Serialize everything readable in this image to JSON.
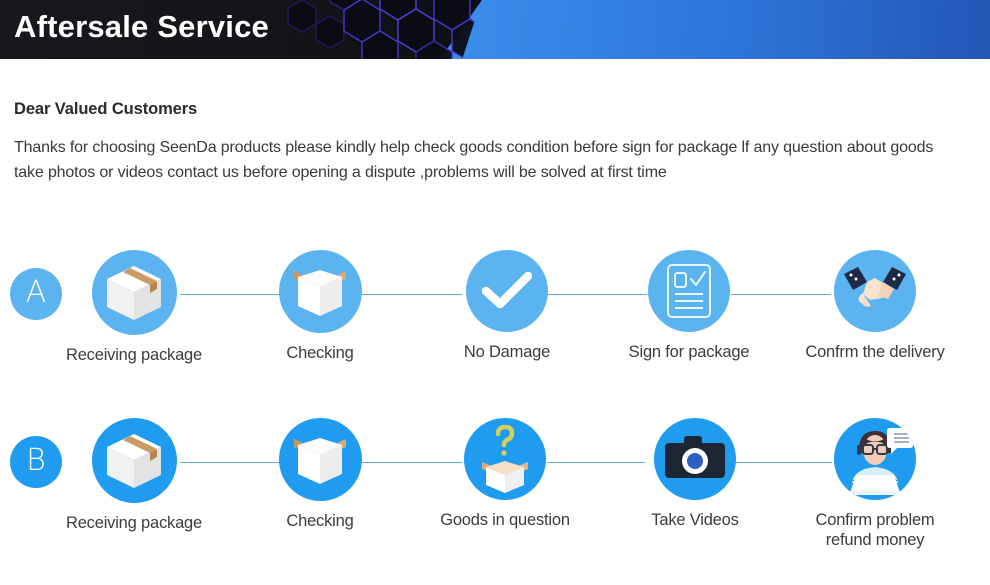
{
  "header": {
    "title": "Aftersale Service",
    "dark_bg": "#14151a",
    "blue_accent": "#3f93f1",
    "hex_stroke": "#3b2ea8"
  },
  "intro": {
    "greeting": "Dear Valued Customers",
    "body": "Thanks for choosing SeenDa products please kindly help check goods condition before sign for package lf any question about goods take photos or videos contact us before opening a dispute ,problems will be solved at first time"
  },
  "colors": {
    "row_a_blue": "#5bb4ef",
    "row_b_blue": "#1f9bf0",
    "connector_line": "#63aecb",
    "label_text": "#3c3c3c",
    "box_tan": "#c99a63",
    "box_white": "#fbfbfb",
    "camera_dark": "#1c2733",
    "handshake_sleeve": "#1f2a46",
    "question_yellow": "#d7cf5a"
  },
  "flows": [
    {
      "badge": "A",
      "steps": [
        {
          "label": "Receiving package",
          "icon": "closed-box-icon"
        },
        {
          "label": "Checking",
          "icon": "open-box-icon"
        },
        {
          "label": "No Damage",
          "icon": "checkmark-icon"
        },
        {
          "label": "Sign for package",
          "icon": "document-check-icon"
        },
        {
          "label": "Confrm the delivery",
          "icon": "handshake-icon"
        }
      ]
    },
    {
      "badge": "B",
      "steps": [
        {
          "label": "Receiving package",
          "icon": "closed-box-icon"
        },
        {
          "label": "Checking",
          "icon": "open-box-icon"
        },
        {
          "label": "Goods in question",
          "icon": "question-box-icon"
        },
        {
          "label": "Take Videos",
          "icon": "camera-icon"
        },
        {
          "label": "Confirm problem\nrefund money",
          "icon": "support-agent-icon"
        }
      ]
    }
  ]
}
